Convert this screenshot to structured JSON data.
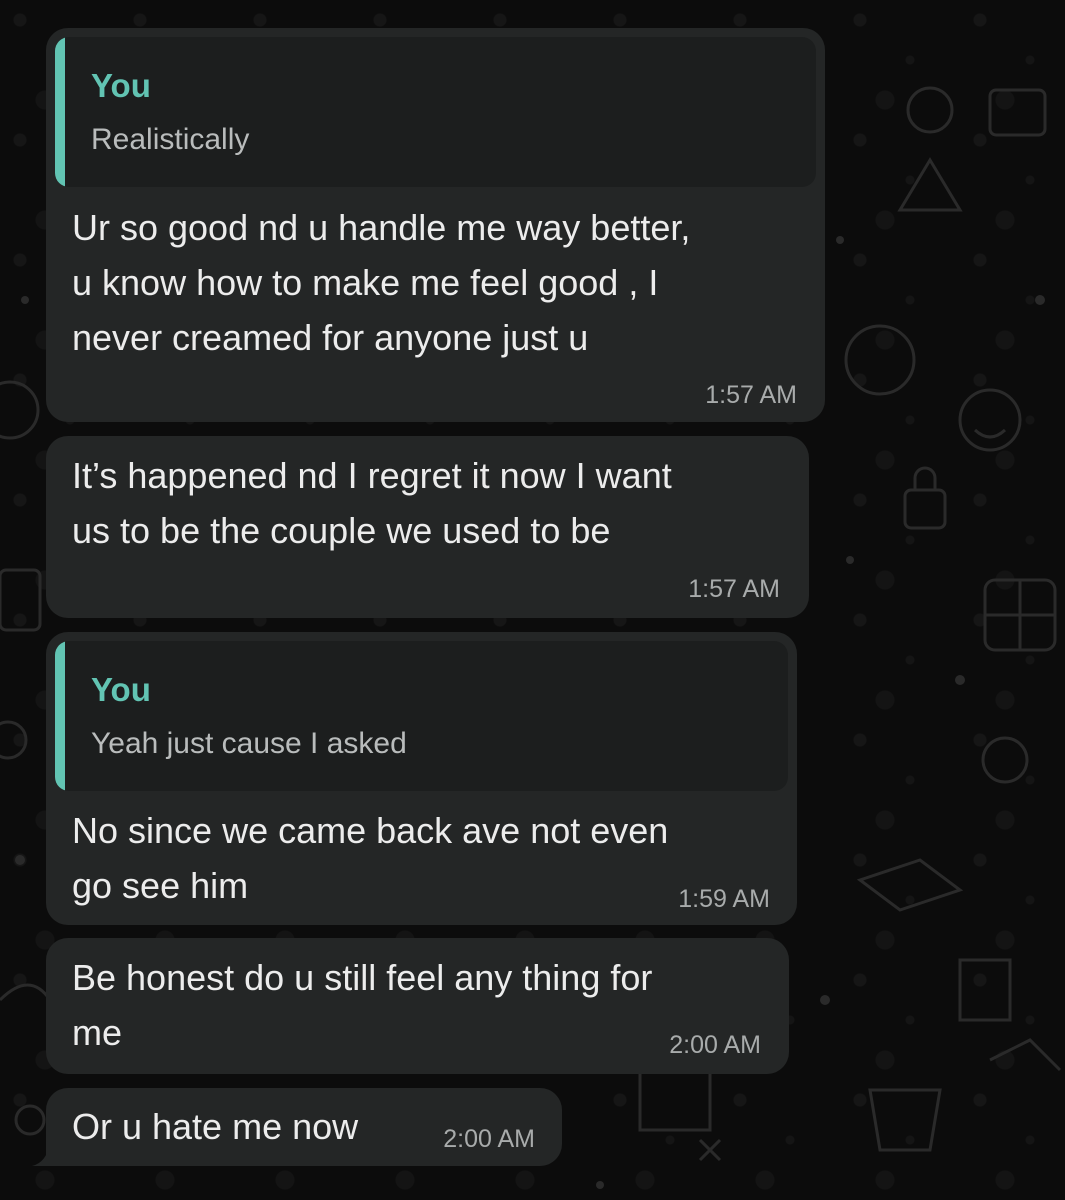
{
  "messages": [
    {
      "quote": {
        "author": "You",
        "text": "Realistically"
      },
      "text": "Ur so good nd u handle me way better,\nu know how to make me feel good , I\nnever creamed for anyone just u",
      "time": "1:57 AM"
    },
    {
      "text": "It’s happened nd I regret it now I want\nus to be the couple we used to be",
      "time": "1:57 AM"
    },
    {
      "quote": {
        "author": "You",
        "text": "Yeah just cause I asked"
      },
      "text": "No since we came back ave not even\ngo see him",
      "time": "1:59 AM"
    },
    {
      "text": "Be honest do u still feel any thing for\nme",
      "time": "2:00 AM"
    },
    {
      "text": "Or u hate me now",
      "time": "2:00 AM"
    }
  ],
  "colors": {
    "background": "#0c0c0c",
    "bubble": "#242626",
    "quote_background": "#1c1e1e",
    "quote_accent": "#62c4b3",
    "text": "#ececec",
    "timestamp": "#a8abab"
  }
}
